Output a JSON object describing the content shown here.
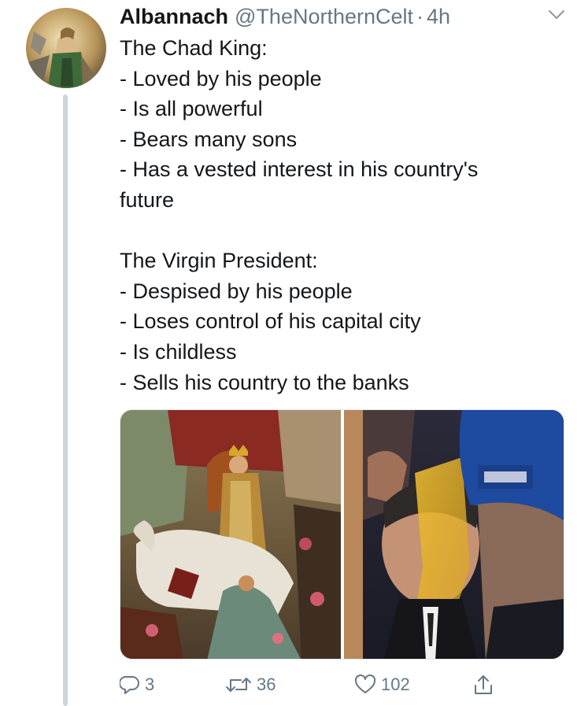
{
  "tweet": {
    "display_name": "Albannach",
    "handle": "@TheNorthernCelt",
    "separator": "·",
    "time": "4h",
    "lines": [
      "The Chad King:",
      "- Loved by his people",
      "- Is all powerful",
      "- Bears many sons",
      "- Has a vested interest in his country's",
      "future",
      "",
      "The Virgin President:",
      "- Despised by his people",
      "- Loses control of his capital city",
      "- Is childless",
      "- Sells his country to the banks"
    ],
    "media": [
      {
        "icon": "painting-king-on-horse"
      },
      {
        "icon": "photo-man-with-egg-on-head"
      }
    ]
  },
  "actions": {
    "reply_count": "3",
    "retweet_count": "36",
    "like_count": "102"
  },
  "colors": {
    "text": "#14171a",
    "secondary": "#657786",
    "thread_line": "#ccd6dd"
  }
}
